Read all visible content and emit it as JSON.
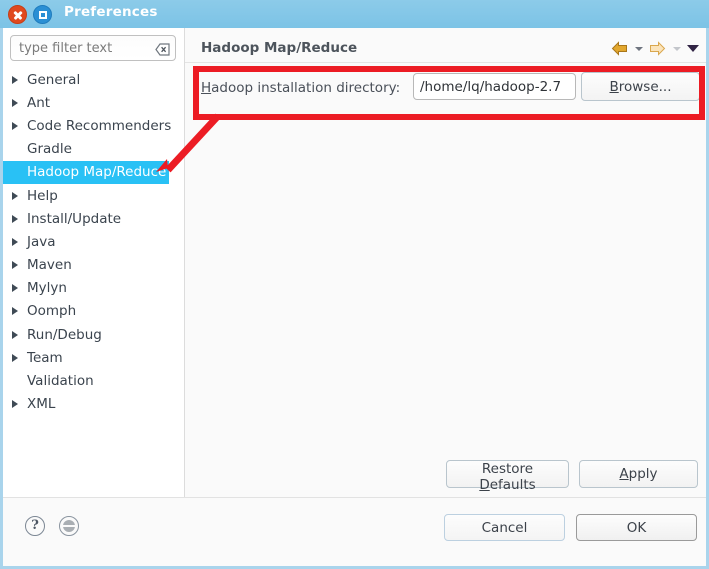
{
  "window": {
    "title": "Preferences",
    "close_icon": "close-icon",
    "maximize_icon": "maximize-icon",
    "titlebar_color": "#84c7e8",
    "border_color": "#a9d4ec"
  },
  "sidebar": {
    "filter": {
      "placeholder": "type filter text",
      "value": "",
      "clear_icon": "clear-filter-icon"
    },
    "selection_color": "#29c1f5",
    "items": [
      {
        "label": "General",
        "expandable": true,
        "selected": false
      },
      {
        "label": "Ant",
        "expandable": true,
        "selected": false
      },
      {
        "label": "Code Recommenders",
        "expandable": true,
        "selected": false
      },
      {
        "label": "Gradle",
        "expandable": false,
        "selected": false
      },
      {
        "label": "Hadoop Map/Reduce",
        "expandable": false,
        "selected": true
      },
      {
        "label": "Help",
        "expandable": true,
        "selected": false
      },
      {
        "label": "Install/Update",
        "expandable": true,
        "selected": false
      },
      {
        "label": "Java",
        "expandable": true,
        "selected": false
      },
      {
        "label": "Maven",
        "expandable": true,
        "selected": false
      },
      {
        "label": "Mylyn",
        "expandable": true,
        "selected": false
      },
      {
        "label": "Oomph",
        "expandable": true,
        "selected": false
      },
      {
        "label": "Run/Debug",
        "expandable": true,
        "selected": false
      },
      {
        "label": "Team",
        "expandable": true,
        "selected": false
      },
      {
        "label": "Validation",
        "expandable": false,
        "selected": false
      },
      {
        "label": "XML",
        "expandable": true,
        "selected": false
      }
    ]
  },
  "panel": {
    "title": "Hadoop Map/Reduce",
    "nav": {
      "back_icon": "back-arrow-icon",
      "back_menu_icon": "chevron-down-icon",
      "forward_icon": "forward-arrow-icon",
      "forward_menu_icon": "chevron-down-icon",
      "view_menu_icon": "view-menu-chevron-icon"
    },
    "field": {
      "label_prefix": "",
      "label_mnemonic": "H",
      "label_rest": "adoop installation directory:",
      "value": "/home/lq/hadoop-2.7",
      "placeholder": ""
    },
    "browse_button": {
      "mnemonic": "B",
      "rest": "rowse..."
    },
    "restore_defaults_button": {
      "prefix": "Restore ",
      "mnemonic": "D",
      "rest": "efaults"
    },
    "apply_button": {
      "mnemonic": "A",
      "rest": "pply"
    }
  },
  "footer": {
    "help_icon": "help-icon",
    "help_glyph": "?",
    "shell_icon": "shell-status-icon",
    "cancel_label": "Cancel",
    "ok_label": "OK"
  },
  "annotations": {
    "color": "#ec1c24",
    "rectangle_target": "hadoop-installation-directory-row",
    "arrow_target": "sidebar-item-hadoop-map-reduce"
  }
}
